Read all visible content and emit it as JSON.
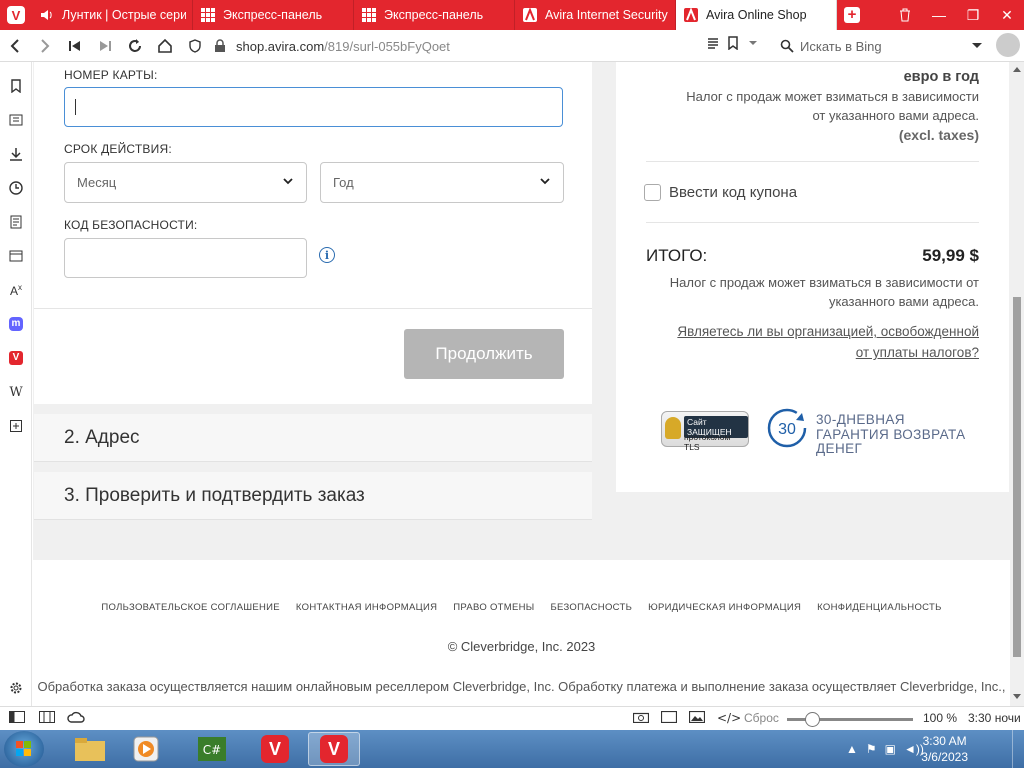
{
  "browser": {
    "tabs": [
      {
        "title": "Лунтик | Острые серии"
      },
      {
        "title": "Экспресс-панель"
      },
      {
        "title": "Экспресс-панель"
      },
      {
        "title": "Avira Internet Security"
      },
      {
        "title": "Avira Online Shop"
      }
    ],
    "url_host": "shop.avira.com",
    "url_path": "/819/surl-055bFyQoet",
    "search_placeholder": "Искать в Bing"
  },
  "form": {
    "card_number_label": "НОМЕР КАРТЫ:",
    "card_number_value": "",
    "expiry_label": "СРОК ДЕЙСТВИЯ:",
    "month_placeholder": "Месяц",
    "year_placeholder": "Год",
    "security_code_label": "КОД БЕЗОПАСНОСТИ:",
    "continue_button": "Продолжить"
  },
  "steps": [
    {
      "label": "2. Адрес"
    },
    {
      "label": "3. Проверить и подтвердить заказ"
    }
  ],
  "summary": {
    "per_year": "евро в год",
    "tax_note_1a": "Налог с продаж может взиматься в зависимости",
    "tax_note_1b": "от указанного вами адреса.",
    "excl_taxes": "(excl. taxes)",
    "coupon_label": "Ввести код купона",
    "total_label": "ИТОГО:",
    "total_value": "59,99 $",
    "tax_note_2a": "Налог с продаж может взиматься в зависимости от",
    "tax_note_2b": "указанного вами адреса.",
    "tax_exempt_link_a": "Являетесь ли вы организацией, освобожденной",
    "tax_exempt_link_b": "от уплаты налогов?",
    "seal_line1": "Сайт ЗАЩИЩЕН",
    "seal_line2": "протоколом TLS",
    "guarantee_badge": "30",
    "guarantee_line1": "30-ДНЕВНАЯ",
    "guarantee_line2": "ГАРАНТИЯ ВОЗВРАТА",
    "guarantee_line3": "ДЕНЕГ"
  },
  "footer": {
    "links": [
      "ПОЛЬЗОВАТЕЛЬСКОЕ СОГЛАШЕНИЕ",
      "КОНТАКТНАЯ ИНФОРМАЦИЯ",
      "ПРАВО ОТМЕНЫ",
      "БЕЗОПАСНОСТЬ",
      "ЮРИДИЧЕСКАЯ ИНФОРМАЦИЯ",
      "КОНФИДЕНЦИАЛЬНОСТЬ"
    ],
    "copyright": "© Cleverbridge, Inc. 2023",
    "legal": "Обработка заказа осуществляется нашим онлайновым реселлером Cleverbridge, Inc. Обработку платежа и выполнение заказа осуществляет Cleverbridge, Inc.,"
  },
  "statusbar": {
    "reset": "Сброс",
    "zoom": "100 %",
    "time": "3:30 ночи",
    "zoom_level": 0.2
  },
  "taskbar": {
    "time": "3:30 AM",
    "date": "3/6/2023"
  },
  "colors": {
    "accent": "#e3262e",
    "focus_border": "#4a8fd6",
    "info_blue": "#2b6cb0"
  }
}
